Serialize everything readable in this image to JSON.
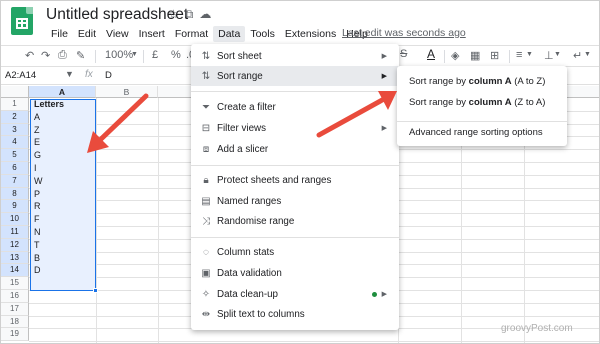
{
  "document": {
    "title": "Untitled spreadsheet",
    "last_edit": "Last edit was seconds ago"
  },
  "menubar": [
    "File",
    "Edit",
    "View",
    "Insert",
    "Format",
    "Data",
    "Tools",
    "Extensions",
    "Help"
  ],
  "toolbar": {
    "zoom": "100%",
    "currency": "£",
    "percent": "%",
    "decimal": ".0"
  },
  "formula_bar": {
    "name_box": "A2:A14",
    "value": "D"
  },
  "columns": [
    "A",
    "B"
  ],
  "rows": [
    "1",
    "2",
    "3",
    "4",
    "5",
    "6",
    "7",
    "8",
    "9",
    "10",
    "11",
    "12",
    "13",
    "14",
    "15",
    "16",
    "17",
    "18",
    "19"
  ],
  "cells": {
    "header": "Letters",
    "values": [
      "A",
      "Z",
      "E",
      "G",
      "I",
      "W",
      "P",
      "R",
      "F",
      "N",
      "T",
      "B",
      "D"
    ]
  },
  "data_menu": {
    "items": [
      {
        "label": "Sort sheet",
        "icon": "sort-icon",
        "submenu": true
      },
      {
        "label": "Sort range",
        "icon": "sort-range-icon",
        "submenu": true,
        "highlighted": true
      },
      {
        "label": "Create a filter",
        "icon": "filter-icon"
      },
      {
        "label": "Filter views",
        "icon": "filter-views-icon",
        "submenu": true
      },
      {
        "label": "Add a slicer",
        "icon": "slicer-icon"
      },
      {
        "label": "Protect sheets and ranges",
        "icon": "lock-icon"
      },
      {
        "label": "Named ranges",
        "icon": "named-ranges-icon"
      },
      {
        "label": "Randomise range",
        "icon": "shuffle-icon"
      },
      {
        "label": "Column stats",
        "icon": "lightbulb-icon"
      },
      {
        "label": "Data validation",
        "icon": "validation-icon"
      },
      {
        "label": "Data clean-up",
        "icon": "clean-up-icon",
        "submenu": true
      },
      {
        "label": "Split text to columns",
        "icon": "split-icon"
      }
    ]
  },
  "sort_submenu": {
    "asc_prefix": "Sort range by ",
    "asc_col": "column A",
    "asc_suffix": " (A to Z)",
    "desc_prefix": "Sort range by ",
    "desc_col": "column A",
    "desc_suffix": " (Z to A)",
    "advanced": "Advanced range sorting options"
  },
  "watermark": "groovyPost.com",
  "colors": {
    "accent": "#1a73e8",
    "selection": "#e8f0fe",
    "arrow": "#e94b3c",
    "sheets_green": "#23a566"
  }
}
